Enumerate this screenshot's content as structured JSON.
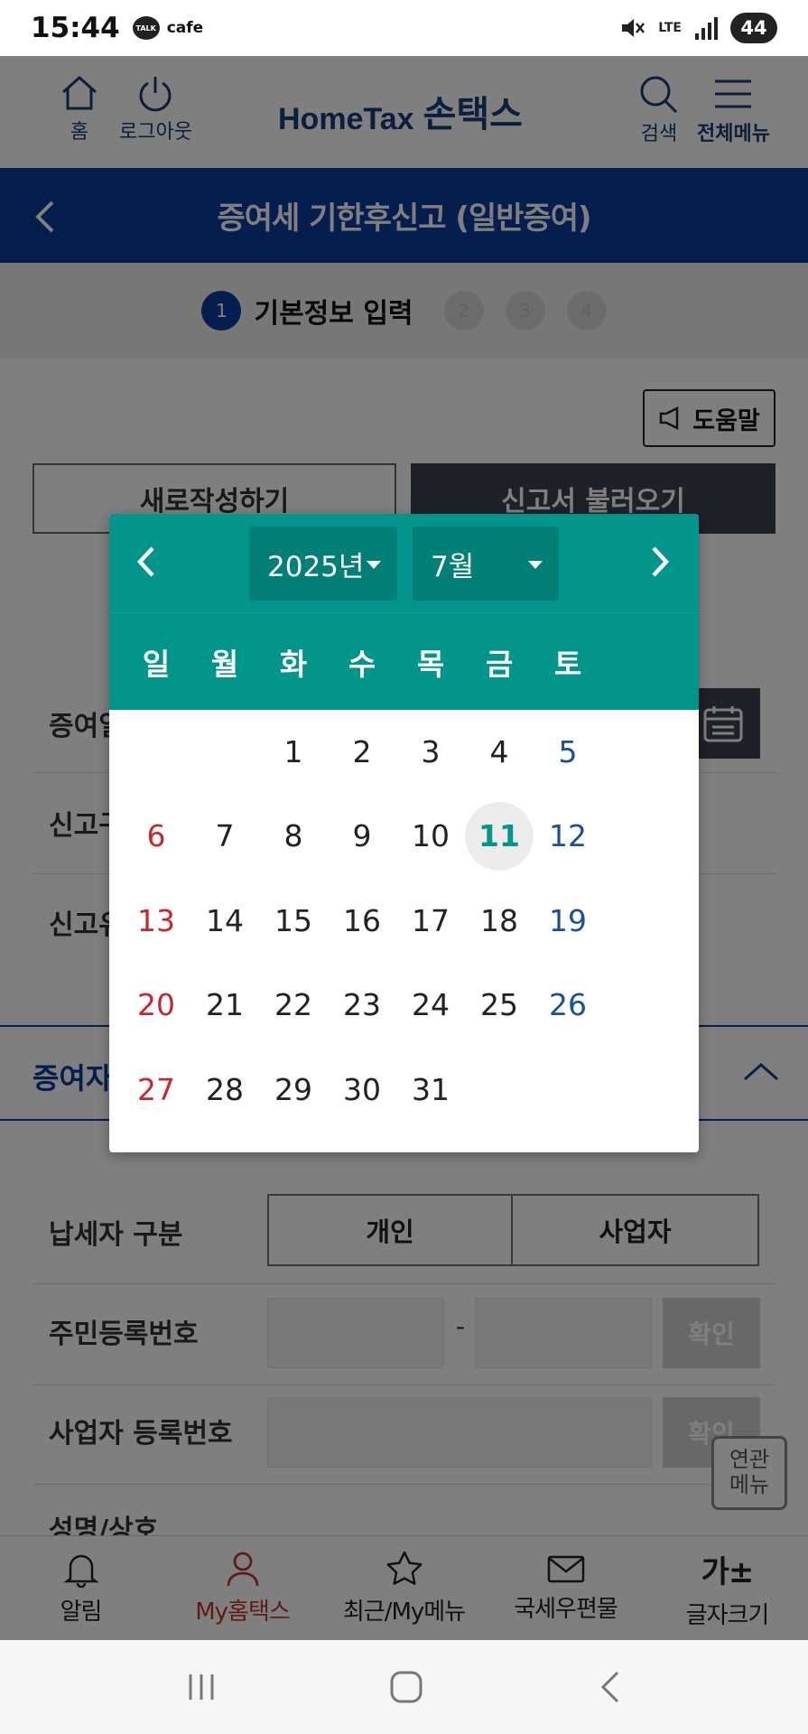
{
  "status_bar": {
    "time": "15:44",
    "talk_badge": "TALK",
    "app_text": "cafe",
    "network": "LTE",
    "battery": "44"
  },
  "header": {
    "home_label": "홈",
    "logout_label": "로그아웃",
    "logo_en": "HomeTax",
    "logo_ko": "손택스",
    "search_label": "검색",
    "menu_label": "전체메뉴"
  },
  "titlebar": {
    "title": "증여세 기한후신고 (일반증여)"
  },
  "steps": {
    "current_number": "1",
    "current_label": "기본정보 입력",
    "next": [
      "2",
      "3",
      "4"
    ]
  },
  "content": {
    "help_label": "도움말",
    "new_button": "새로작성하기",
    "load_button": "신고서 불러오기",
    "row1_label": "증여일",
    "row2_label": "신고구",
    "row3_label": "신고유",
    "section_label": "증여자",
    "taxpayer_label": "납세자 구분",
    "taxpayer_options": [
      "개인",
      "사업자"
    ],
    "resident_label": "주민등록번호",
    "business_label": "사업자 등록번호",
    "name_label": "성명/상호",
    "dash": "-",
    "confirm_label": "확인",
    "related_menu": [
      "연관",
      "메뉴"
    ]
  },
  "datepicker": {
    "year": "2025년",
    "month": "7월",
    "weekdays": [
      "일",
      "월",
      "화",
      "수",
      "목",
      "금",
      "토"
    ],
    "weeks": [
      [
        "",
        "",
        "1",
        "2",
        "3",
        "4",
        "5"
      ],
      [
        "6",
        "7",
        "8",
        "9",
        "10",
        "11",
        "12"
      ],
      [
        "13",
        "14",
        "15",
        "16",
        "17",
        "18",
        "19"
      ],
      [
        "20",
        "21",
        "22",
        "23",
        "24",
        "25",
        "26"
      ],
      [
        "27",
        "28",
        "29",
        "30",
        "31",
        "",
        ""
      ]
    ],
    "today": "11",
    "colors": {
      "header": "#02958b",
      "select": "#027f76",
      "sunday": "#c8262d",
      "saturday": "#1a4f9c"
    }
  },
  "tabbar": {
    "items": [
      "알림",
      "My홈택스",
      "최근/My메뉴",
      "국세우편물",
      "글자크기"
    ],
    "text_size_glyph": "가±",
    "active_index": 1
  }
}
